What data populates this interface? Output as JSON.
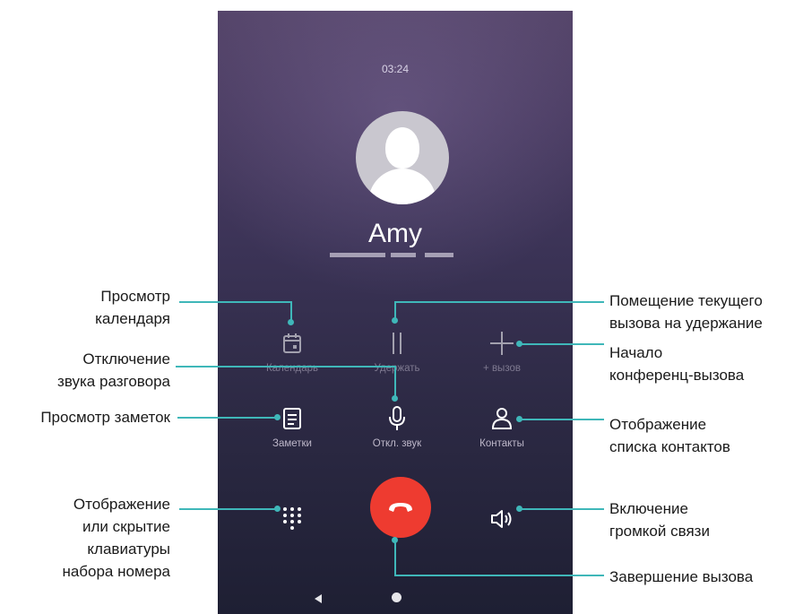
{
  "call": {
    "duration": "03:24",
    "contact_name": "Amy"
  },
  "buttons": {
    "calendar": {
      "label": "Календарь",
      "icon": "calendar-icon"
    },
    "hold": {
      "label": "Удержать",
      "icon": "pause-icon"
    },
    "add_call": {
      "label": "+ вызов",
      "icon": "plus-icon"
    },
    "notes": {
      "label": "Заметки",
      "icon": "notes-icon"
    },
    "mute": {
      "label": "Откл. звук",
      "icon": "microphone-icon"
    },
    "contacts": {
      "label": "Контакты",
      "icon": "contact-icon"
    },
    "dialpad": {
      "icon": "dialpad-icon"
    },
    "end_call": {
      "icon": "hang-up-icon",
      "color": "#ee3b30"
    },
    "speaker": {
      "icon": "speaker-icon"
    }
  },
  "navigation": {
    "back": {
      "icon": "back-triangle-icon"
    },
    "home": {
      "icon": "home-circle-icon"
    }
  },
  "annotations": {
    "calendar_line1": "Просмотр",
    "calendar_line2": "календаря",
    "mute_line1": "Отключение",
    "mute_line2": "звука разговора",
    "notes": "Просмотр заметок",
    "dialpad_line1": "Отображение",
    "dialpad_line2": "или скрытие",
    "dialpad_line3": "клавиатуры",
    "dialpad_line4": "набора номера",
    "hold_line1": "Помещение текущего",
    "hold_line2": "вызова на удержание",
    "conference_line1": "Начало",
    "conference_line2": "конференц-вызова",
    "contacts_line1": "Отображение",
    "contacts_line2": "списка контактов",
    "speaker_line1": "Включение",
    "speaker_line2": "громкой связи",
    "end_call": "Завершение вызова"
  },
  "colors": {
    "annotation_line": "#3fb7b9",
    "end_call": "#ee3b30",
    "background_top": "#55456a",
    "background_bottom": "#1e1f33"
  }
}
